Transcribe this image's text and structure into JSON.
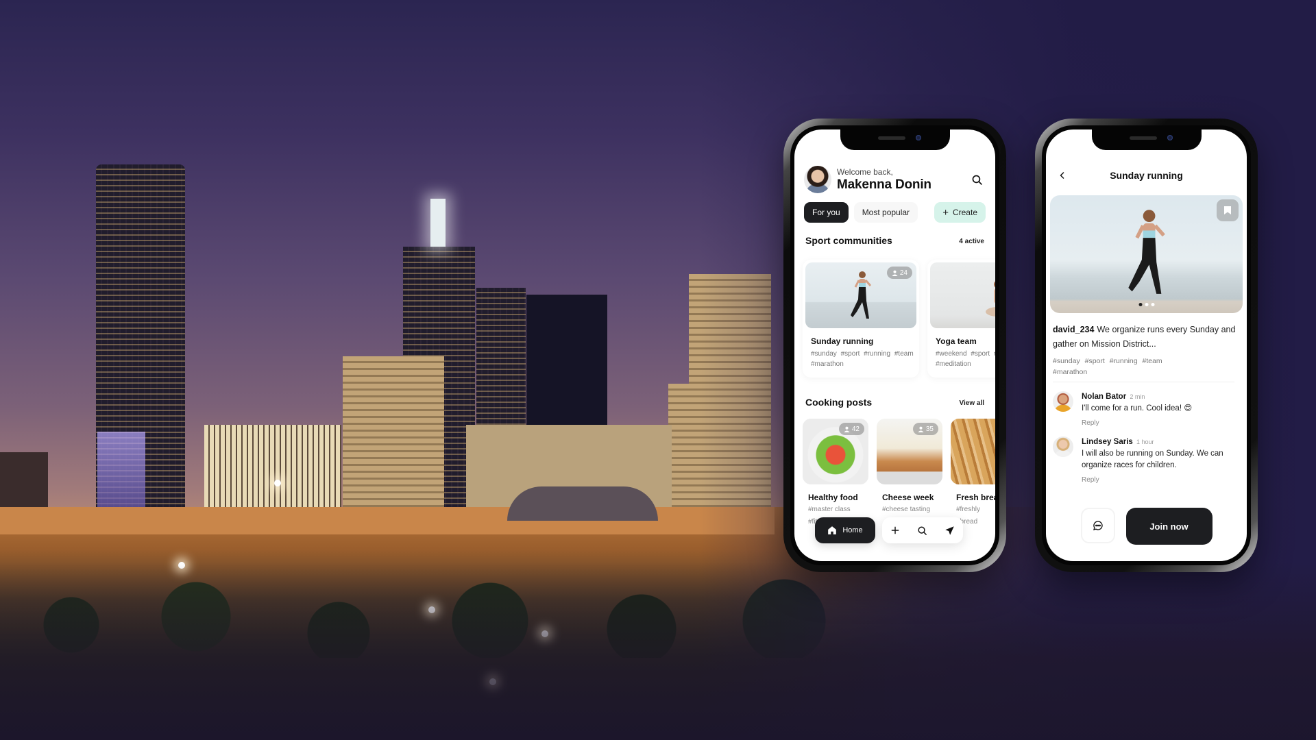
{
  "colors": {
    "background_night": "#231c47",
    "dark_button": "#1d1e21",
    "create_chip": "#d6f3ea",
    "screen_bg": "#ffffff"
  },
  "home_screen": {
    "greeting": "Welcome back,",
    "user_name": "Makenna Donin",
    "search_icon": "search-icon",
    "tabs": [
      {
        "label": "For you",
        "active": true
      },
      {
        "label": "Most popular",
        "active": false
      }
    ],
    "create_button": {
      "icon": "+",
      "label": "Create"
    },
    "sport_section": {
      "title": "Sport communities",
      "aside": "4 active",
      "cards": [
        {
          "title": "Sunday running",
          "members": "24",
          "tags": "#sunday #sport #running #team #marathon"
        },
        {
          "title": "Yoga team",
          "members": "",
          "tags": "#weekend #sport #team #meditation"
        }
      ]
    },
    "cooking_section": {
      "title": "Cooking posts",
      "aside": "View all",
      "cards": [
        {
          "title": "Healthy food",
          "members": "42",
          "tags_line1": "#master class",
          "tags_line2": "#fit"
        },
        {
          "title": "Cheese week",
          "members": "35",
          "tags_line1": "#cheese tasting",
          "tags_line2": ""
        },
        {
          "title": "Fresh bread",
          "members": "",
          "tags_line1": "#freshly",
          "tags_line2": "#bread"
        }
      ]
    },
    "bottom_nav": {
      "home_label": "Home",
      "items": [
        "home-icon",
        "plus-icon",
        "search-icon",
        "send-icon"
      ]
    }
  },
  "detail_screen": {
    "title": "Sunday running",
    "carousel": {
      "pages": 3,
      "current": 1
    },
    "post": {
      "author": "david_234",
      "text": "We organize runs every Sunday and gather on Mission District...",
      "tags_line1": "#sunday #sport #running #team",
      "tags_line2": "#marathon"
    },
    "comments": [
      {
        "name": "Nolan Bator",
        "time": "2 min",
        "text": "I'll come for a run. Cool idea! 😍",
        "reply": "Reply"
      },
      {
        "name": "Lindsey Saris",
        "time": "1 hour",
        "text": "I will also be running on Sunday. We can organize races for children.",
        "reply": "Reply"
      }
    ],
    "join_button": "Join now"
  }
}
